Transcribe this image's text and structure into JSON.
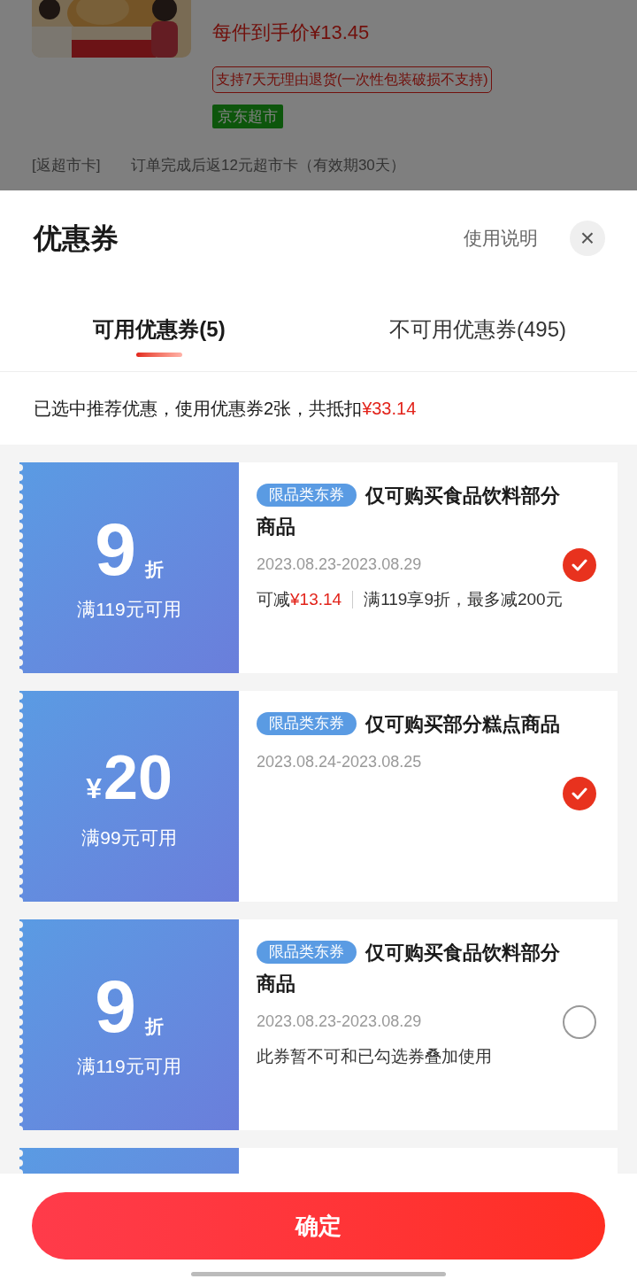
{
  "background_page": {
    "unit_price": "每件到手价¥13.45",
    "return_policy": "支持7天无理由退货(一次性包装破损不支持)",
    "store_tag": "京东超市",
    "rebate_label": "[返超市卡]",
    "rebate_text": "订单完成后返12元超市卡（有效期30天）"
  },
  "sheet": {
    "title": "优惠券",
    "help_link": "使用说明",
    "close": "×"
  },
  "tabs": [
    {
      "label": "可用优惠券(5)",
      "selected": true
    },
    {
      "label": "不可用优惠券(495)",
      "selected": false
    }
  ],
  "summary": "已选中推荐优惠，使用优惠券2张，共抵扣**¥33.14**",
  "coupons": [
    {
      "kind": "discount",
      "value": "9",
      "unit": "折",
      "condition": "满119元可用",
      "tag": "限品类东券",
      "title": "仅可购买食品饮料部分商品",
      "validity": "2023.08.23-2023.08.29",
      "saving_label": "可减",
      "saving": "¥13.14",
      "rule": "满119享9折，最多减200元",
      "checked": true
    },
    {
      "kind": "amount",
      "value": "20",
      "unit": "¥",
      "condition": "满99元可用",
      "tag": "限品类东券",
      "title": "仅可购买部分糕点商品",
      "validity": "2023.08.24-2023.08.25",
      "checked": true
    },
    {
      "kind": "discount",
      "value": "9",
      "unit": "折",
      "condition": "满119元可用",
      "tag": "限品类东券",
      "title": "仅可购买食品饮料部分商品",
      "validity": "2023.08.23-2023.08.29",
      "note": "此券暂不可和已勾选券叠加使用",
      "checked": false
    }
  ],
  "confirm_button": "确定"
}
